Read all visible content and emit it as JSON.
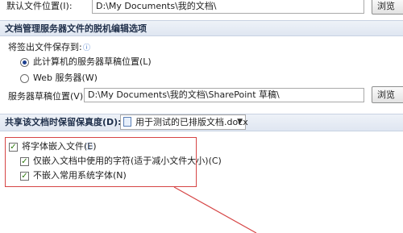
{
  "default_location": {
    "label": "默认文件位置(I):",
    "value": "D:\\My Documents\\我的文档\\",
    "browse_label": "浏览"
  },
  "offline_section": {
    "title": "文档管理服务器文件的脱机编辑选项",
    "save_to_label": "将签出文件保存到:",
    "info_icon": "info-icon",
    "radio_local": "此计算机的服务器草稿位置(L)",
    "radio_web": "Web 服务器(W)",
    "drafts_label": "服务器草稿位置(V):",
    "drafts_value": "D:\\My Documents\\我的文档\\SharePoint 草稿\\",
    "browse_label": "浏览"
  },
  "fidelity": {
    "label": "共享该文档时保留保真度(D):",
    "doc_name": "用于测试的已排版文档.docx"
  },
  "fonts": {
    "embed_label": "将字体嵌入文件(E)",
    "only_used_label": "仅嵌入文档中使用的字符(适于减小文件大小)(C)",
    "no_common_label": "不嵌入常用系统字体(N)"
  },
  "colors": {
    "annotation": "#d64545",
    "section_bg": "#e4eaf4"
  }
}
